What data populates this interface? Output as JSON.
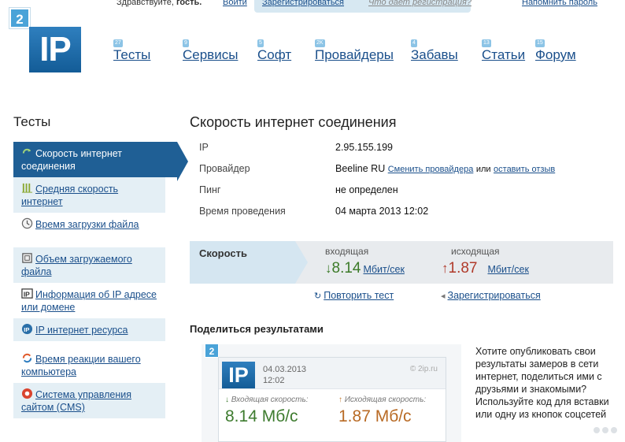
{
  "topbar": {
    "greeting": "Здравствуйте, ",
    "guest": "гость.",
    "login": "Войти",
    "register": "Зарегистрироваться",
    "why_register": "Что дает регистрация?",
    "remind_password": "Напомнить пароль"
  },
  "logo": {
    "tab": "2",
    "main": "IP"
  },
  "nav": [
    {
      "count": "27",
      "label": "Тесты"
    },
    {
      "count": "9",
      "label": "Сервисы"
    },
    {
      "count": "5",
      "label": "Софт"
    },
    {
      "count": "2K",
      "label": "Провайдеры"
    },
    {
      "count": "4",
      "label": "Забавы"
    },
    {
      "count": "13",
      "label": "Статьи"
    },
    {
      "count": "15",
      "label": "Форум"
    }
  ],
  "sidebar": {
    "title": "Тесты",
    "items": [
      {
        "label": "Скорость интернет соединения",
        "icon": "speed-test-icon"
      },
      {
        "label": "Средняя скорость интернет",
        "icon": "bars-icon"
      },
      {
        "label": "Время загрузки файла",
        "icon": "clock-icon"
      },
      {
        "label": "Объем загружаемого файла",
        "icon": "file-size-icon"
      },
      {
        "label": "Информация об IP адресе или домене",
        "icon": "ip-info-icon"
      },
      {
        "label": "IP интернет ресурса",
        "icon": "ip-resource-icon"
      },
      {
        "label": "Время реакции вашего компьютера",
        "icon": "refresh-icon"
      },
      {
        "label": "Система управления сайтом (CMS)",
        "icon": "cms-icon"
      }
    ]
  },
  "main": {
    "title": "Скорость интернет соединения",
    "info": {
      "ip_label": "IP",
      "ip_value": "2.95.155.199",
      "provider_label": "Провайдер",
      "provider_value": "Beeline RU",
      "change_provider": "Сменить провайдера",
      "or": "или",
      "leave_review": "оставить отзыв",
      "ping_label": "Пинг",
      "ping_value": "не определен",
      "time_label": "Время проведения",
      "time_value": "04 марта 2013 12:02"
    },
    "speed": {
      "label": "Скорость",
      "incoming_label": "входящая",
      "incoming_arrow": "↓",
      "incoming_value": "8.14",
      "outgoing_label": "исходящая",
      "outgoing_arrow": "↑",
      "outgoing_value": "1.87",
      "unit": "Мбит/сек"
    },
    "actions": {
      "retest": "Повторить тест",
      "register": "Зарегистрироваться"
    },
    "share": {
      "title": "Поделиться результатами",
      "card": {
        "tab": "2",
        "logo": "IP",
        "date": "04.03.2013",
        "time": "12:02",
        "source": "© 2ip.ru",
        "incoming_label": "Входящая скорость:",
        "incoming_value": "8.14 Мб/с",
        "outgoing_label": "Исходящая скорость:",
        "outgoing_value": "1.87 Мб/с"
      },
      "text": "Хотите опубликовать свои результаты замеров в сети интернет, поделиться ими с друзьями и знакомыми? Используйте код для вставки или одну из кнопок соцсетей"
    }
  },
  "colors": {
    "brand_blue": "#1f5f95",
    "link": "#1a4f8b",
    "incoming_green": "#3b7a28",
    "outgoing_red": "#b03a2a"
  }
}
